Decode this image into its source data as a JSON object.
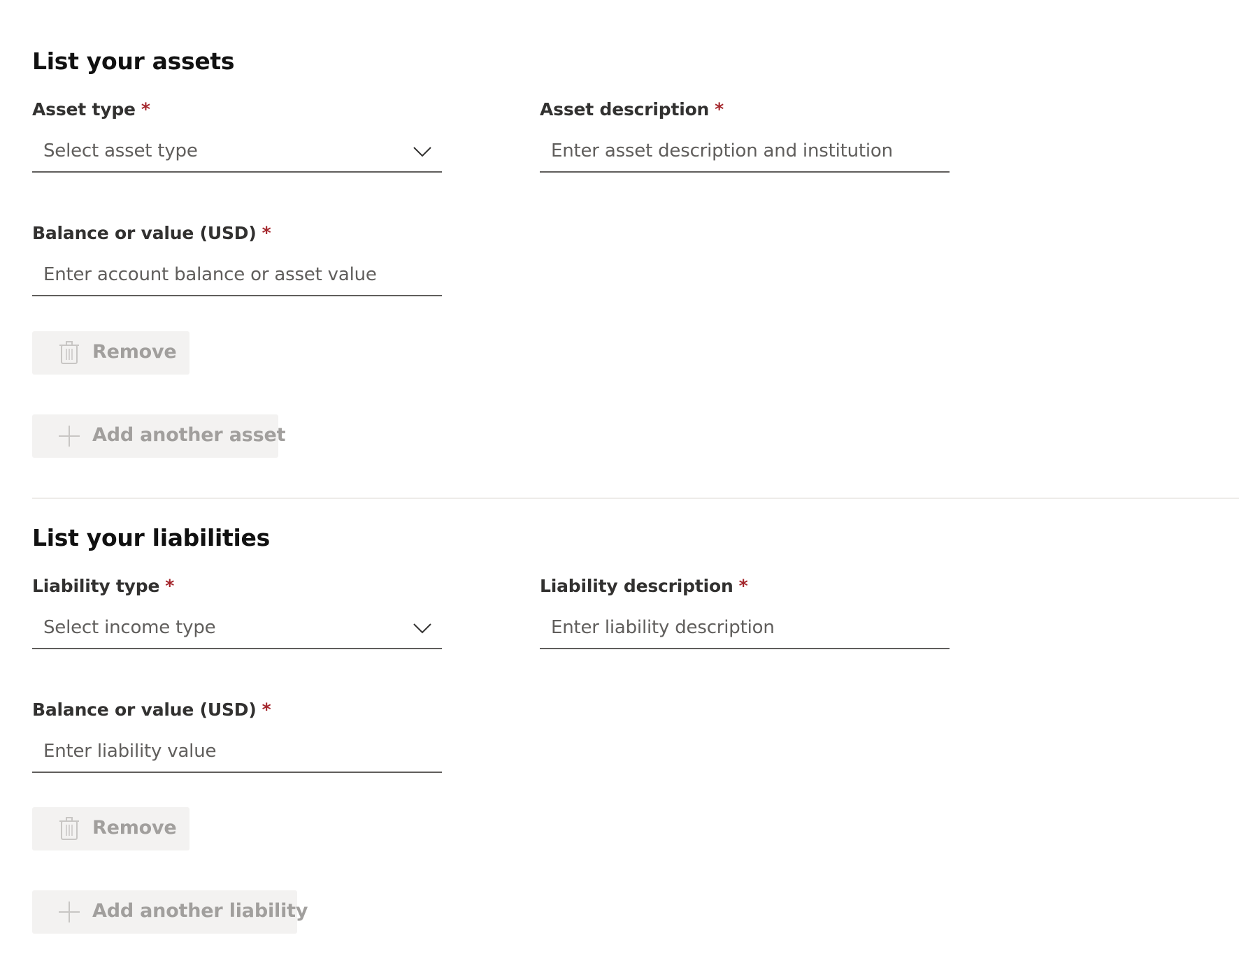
{
  "assets": {
    "title": "List your assets",
    "type_label": "Asset type",
    "type_placeholder": "Select asset type",
    "description_label": "Asset description",
    "description_placeholder": "Enter asset description and institution",
    "balance_label": "Balance or value (USD)",
    "balance_placeholder": "Enter account balance or asset value",
    "remove_label": "Remove",
    "add_label": "Add another asset"
  },
  "liabilities": {
    "title": "List your liabilities",
    "type_label": "Liability type",
    "type_placeholder": "Select income type",
    "description_label": "Liability description",
    "description_placeholder": "Enter liability description",
    "balance_label": "Balance or value (USD)",
    "balance_placeholder": "Enter liability value",
    "remove_label": "Remove",
    "add_label": "Add another liability"
  },
  "required_marker": "*",
  "colors": {
    "required": "#a4262c",
    "disabled_button_bg": "#f3f2f1",
    "disabled_text": "#a19f9d",
    "field_border": "#605e5c"
  },
  "icons": {
    "dropdown": "chevron-down-icon",
    "remove": "trash-icon",
    "add": "plus-icon"
  }
}
